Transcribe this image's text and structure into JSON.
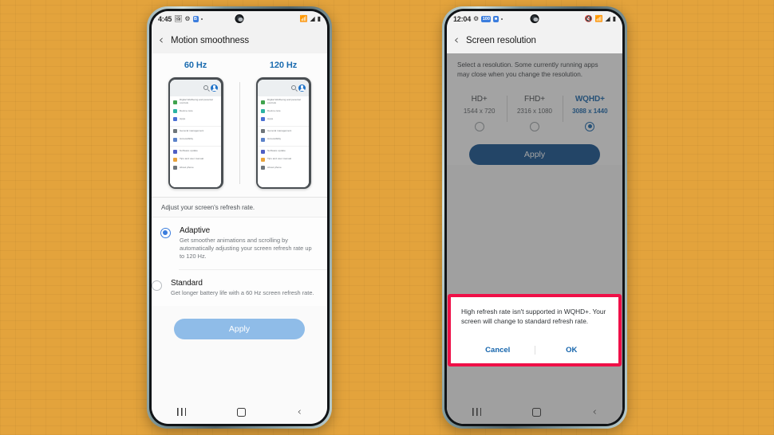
{
  "left_phone": {
    "status_bar": {
      "time": "4:45",
      "icons": [
        "image-icon",
        "gear-icon",
        "badge-icon",
        "dot-icon"
      ],
      "right_icons": [
        "wifi-icon",
        "signal-icon",
        "battery-icon"
      ]
    },
    "header": {
      "back": "‹",
      "title": "Motion smoothness"
    },
    "preview": {
      "left_label": "60 Hz",
      "right_label": "120 Hz",
      "list_items": [
        "Digital Wellbeing and parental controls",
        "Device care",
        "Apps",
        "General management",
        "Accessibility",
        "Software update",
        "Tips and user manual",
        "About phone"
      ],
      "item_colors": [
        "#3fa34d",
        "#2bb3a3",
        "#4a6fd4",
        "#6e757a",
        "#5b82c9",
        "#4f5fc4",
        "#e8a33d",
        "#6e757a"
      ]
    },
    "hint": "Adjust your screen's refresh rate.",
    "options": [
      {
        "title": "Adaptive",
        "desc": "Get smoother animations and scrolling by automatically adjusting your screen refresh rate up to 120 Hz.",
        "selected": true
      },
      {
        "title": "Standard",
        "desc": "Get longer battery life with a 60 Hz screen refresh rate.",
        "selected": false
      }
    ],
    "apply_label": "Apply",
    "apply_color": "#8fbce8",
    "nav": {
      "recent": "recent-apps-icon",
      "home": "home-icon",
      "back": "‹"
    }
  },
  "right_phone": {
    "status_bar": {
      "time": "12:04",
      "icons": [
        "gear-icon",
        "100",
        "app-badge-icon",
        "dot-icon"
      ],
      "right_icons": [
        "mute-icon",
        "wifi-icon",
        "signal-icon",
        "battery-icon"
      ]
    },
    "header": {
      "back": "‹",
      "title": "Screen resolution"
    },
    "description": "Select a resolution. Some currently running apps may close when you change the resolution.",
    "resolutions": [
      {
        "name": "HD+",
        "dims": "1544 x 720",
        "selected": false
      },
      {
        "name": "FHD+",
        "dims": "2316 x 1080",
        "selected": false
      },
      {
        "name": "WQHD+",
        "dims": "3088 x 1440",
        "selected": true
      }
    ],
    "apply_label": "Apply",
    "apply_color": "#0e4f8f",
    "dialog": {
      "message": "High refresh rate isn't supported in WQHD+. Your screen will change to standard refresh rate.",
      "cancel_label": "Cancel",
      "ok_label": "OK",
      "highlight_color": "#ef0f47"
    },
    "nav": {
      "recent": "recent-apps-icon",
      "home": "home-icon",
      "back": "‹"
    }
  },
  "theme": {
    "background": "#e3a33c",
    "accent_blue": "#1464ac",
    "link_blue": "#3b7ddd"
  }
}
